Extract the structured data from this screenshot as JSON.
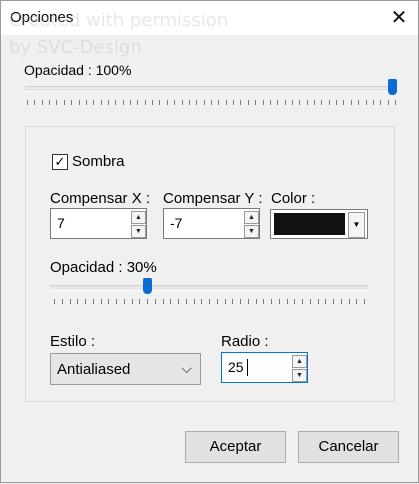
{
  "window": {
    "title": "Opciones",
    "close_glyph": "✕"
  },
  "watermark": {
    "line1": "Created with permission",
    "line2": "by SVC-Design",
    "url": "https://margit1928841201416.blogspot.com"
  },
  "opacity_main": {
    "label": "Opacidad : 100%",
    "value": 100
  },
  "shadow": {
    "checkbox_label": "Sombra",
    "checked": true,
    "offset_x": {
      "label": "Compensar X :",
      "value": "7"
    },
    "offset_y": {
      "label": "Compensar Y :",
      "value": "-7"
    },
    "color": {
      "label": "Color :",
      "value": "#111111"
    },
    "opacity": {
      "label": "Opacidad : 30%",
      "value": 30
    },
    "style": {
      "label": "Estilo :",
      "value": "Antialiased"
    },
    "radius": {
      "label": "Radio :",
      "value": "25"
    }
  },
  "buttons": {
    "accept": "Aceptar",
    "cancel": "Cancelar"
  },
  "icons": {
    "close": "close-icon",
    "check": "check-icon",
    "spin_up": "chevron-up-icon",
    "spin_down": "chevron-down-icon",
    "dropdown": "chevron-down-icon"
  },
  "colors": {
    "accent": "#0a6ad6",
    "selection": "#0078d7"
  }
}
